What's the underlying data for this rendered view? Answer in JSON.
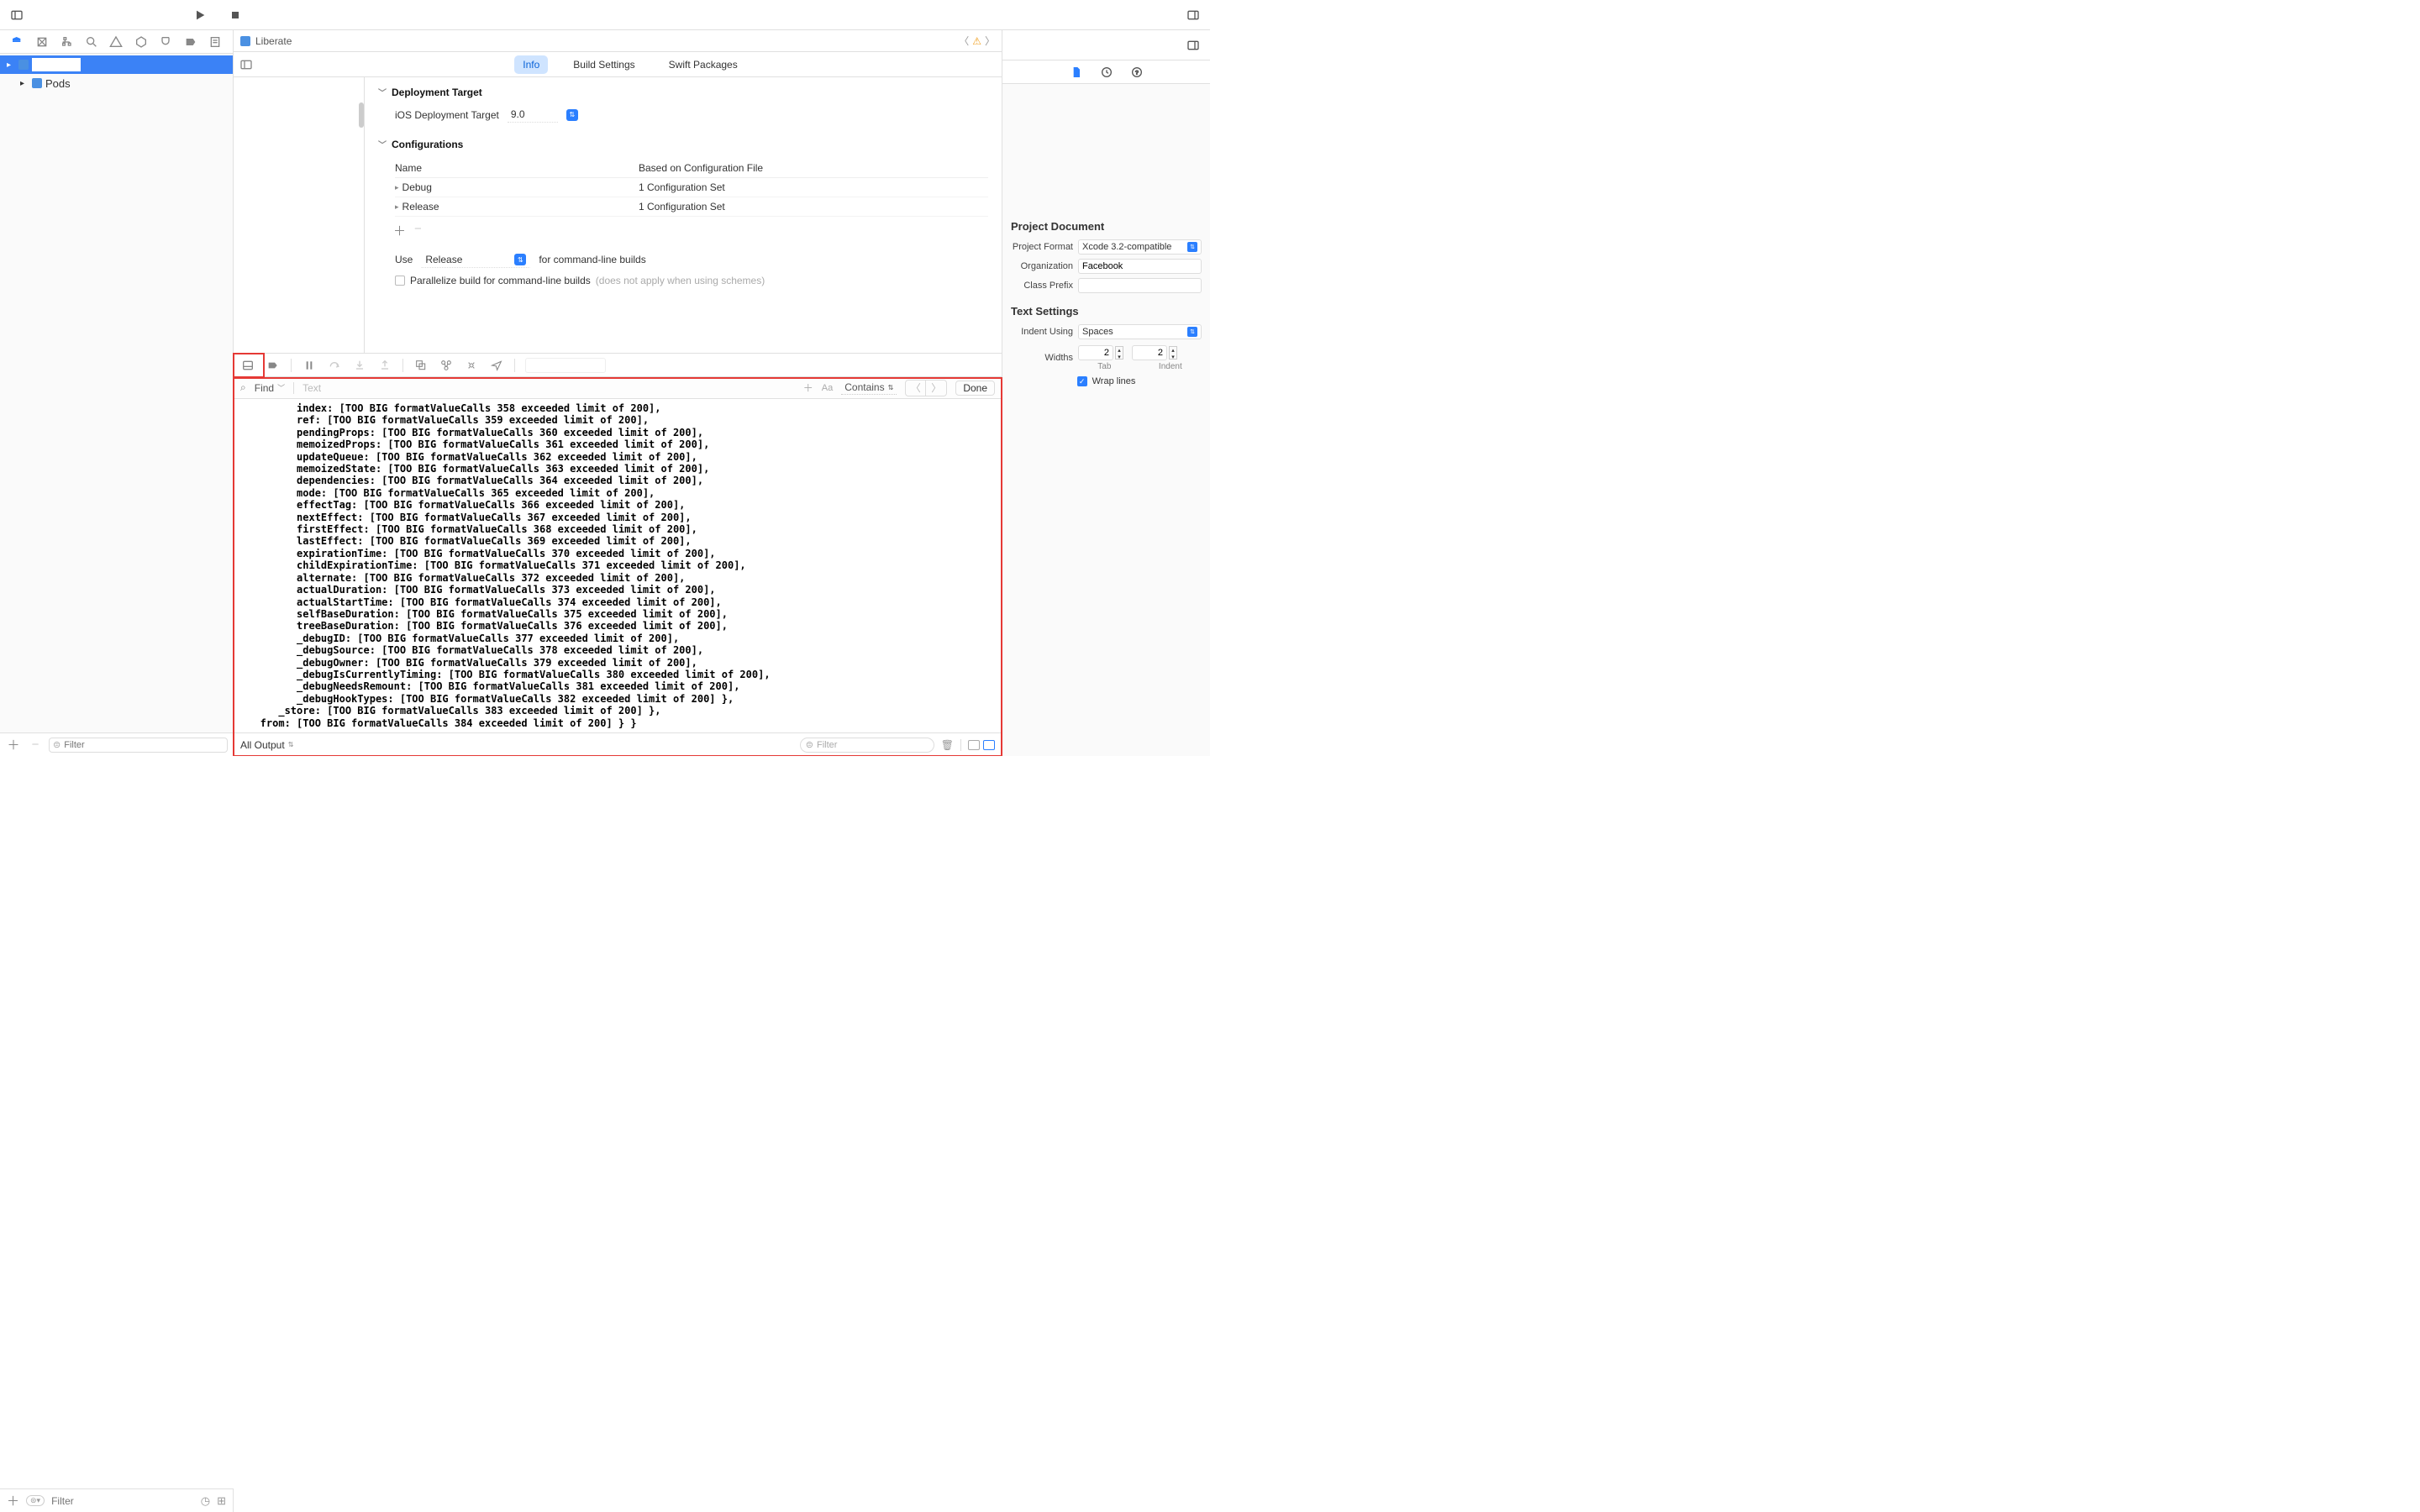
{
  "toolbar": {},
  "navigator": {
    "tree": {
      "project_name": "",
      "pods": "Pods"
    },
    "filter_placeholder": "Filter"
  },
  "editor": {
    "breadcrumb": "Liberate",
    "tabs": {
      "info": "Info",
      "build": "Build Settings",
      "swift": "Swift Packages"
    },
    "deployment": {
      "title": "Deployment Target",
      "ios_label": "iOS Deployment Target",
      "ios_value": "9.0"
    },
    "configurations": {
      "title": "Configurations",
      "hdr_name": "Name",
      "hdr_based": "Based on Configuration File",
      "rows": [
        {
          "name": "Debug",
          "based": "1 Configuration Set"
        },
        {
          "name": "Release",
          "based": "1 Configuration Set"
        }
      ],
      "use_label": "Use",
      "use_value": "Release",
      "use_suffix": "for command-line builds",
      "parallelize": "Parallelize build for command-line builds",
      "parallelize_hint": "(does not apply when using schemes)"
    }
  },
  "findbar": {
    "mode": "Find",
    "placeholder": "Text",
    "contains": "Contains",
    "done": "Done"
  },
  "console": {
    "lines": [
      "index: [TOO BIG formatValueCalls 358 exceeded limit of 200],",
      "ref: [TOO BIG formatValueCalls 359 exceeded limit of 200],",
      "pendingProps: [TOO BIG formatValueCalls 360 exceeded limit of 200],",
      "memoizedProps: [TOO BIG formatValueCalls 361 exceeded limit of 200],",
      "updateQueue: [TOO BIG formatValueCalls 362 exceeded limit of 200],",
      "memoizedState: [TOO BIG formatValueCalls 363 exceeded limit of 200],",
      "dependencies: [TOO BIG formatValueCalls 364 exceeded limit of 200],",
      "mode: [TOO BIG formatValueCalls 365 exceeded limit of 200],",
      "effectTag: [TOO BIG formatValueCalls 366 exceeded limit of 200],",
      "nextEffect: [TOO BIG formatValueCalls 367 exceeded limit of 200],",
      "firstEffect: [TOO BIG formatValueCalls 368 exceeded limit of 200],",
      "lastEffect: [TOO BIG formatValueCalls 369 exceeded limit of 200],",
      "expirationTime: [TOO BIG formatValueCalls 370 exceeded limit of 200],",
      "childExpirationTime: [TOO BIG formatValueCalls 371 exceeded limit of 200],",
      "alternate: [TOO BIG formatValueCalls 372 exceeded limit of 200],",
      "actualDuration: [TOO BIG formatValueCalls 373 exceeded limit of 200],",
      "actualStartTime: [TOO BIG formatValueCalls 374 exceeded limit of 200],",
      "selfBaseDuration: [TOO BIG formatValueCalls 375 exceeded limit of 200],",
      "treeBaseDuration: [TOO BIG formatValueCalls 376 exceeded limit of 200],",
      "_debugID: [TOO BIG formatValueCalls 377 exceeded limit of 200],",
      "_debugSource: [TOO BIG formatValueCalls 378 exceeded limit of 200],",
      "_debugOwner: [TOO BIG formatValueCalls 379 exceeded limit of 200],",
      "_debugIsCurrentlyTiming: [TOO BIG formatValueCalls 380 exceeded limit of 200],",
      "_debugNeedsRemount: [TOO BIG formatValueCalls 381 exceeded limit of 200],",
      "_debugHookTypes: [TOO BIG formatValueCalls 382 exceeded limit of 200] },",
      "_store: [TOO BIG formatValueCalls 383 exceeded limit of 200] },",
      "from: [TOO BIG formatValueCalls 384 exceeded limit of 200] } }"
    ],
    "footer_mode": "All Output",
    "filter_placeholder": "Filter"
  },
  "inspector": {
    "project_doc": "Project Document",
    "project_format_label": "Project Format",
    "project_format_value": "Xcode 3.2-compatible",
    "organization_label": "Organization",
    "organization_value": "Facebook",
    "class_prefix_label": "Class Prefix",
    "class_prefix_value": "",
    "text_settings": "Text Settings",
    "indent_using_label": "Indent Using",
    "indent_using_value": "Spaces",
    "widths_label": "Widths",
    "tab_value": "2",
    "tab_label": "Tab",
    "indent_value": "2",
    "indent_label": "Indent",
    "wrap_lines": "Wrap lines"
  },
  "bottombar": {
    "filter_placeholder": "Filter"
  }
}
